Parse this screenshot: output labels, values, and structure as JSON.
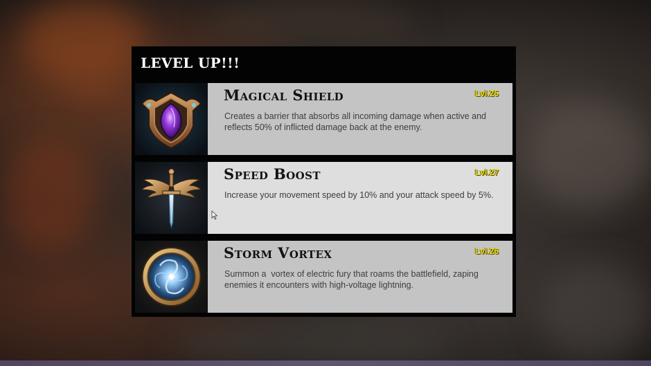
{
  "dialog": {
    "title": "LEVEL UP!!!"
  },
  "cards": [
    {
      "name": "Magical Shield",
      "level": "Lvl.25",
      "description": "Creates a barrier that absorbs all incoming damage when active and reflects 50% of inflicted damage back at the enemy.",
      "icon": "magic-shield-icon"
    },
    {
      "name": "Speed Boost",
      "level": "Lvl.27",
      "description": "Increase your movement speed by 10% and your attack speed by 5%.",
      "icon": "winged-sword-icon"
    },
    {
      "name": "Storm Vortex",
      "level": "Lvl.26",
      "description": "Summon a  vortex of electric fury that roams the battlefield, zaping enemies it encounters with high-voltage lightning.",
      "icon": "vortex-medallion-icon"
    }
  ],
  "colors": {
    "level_text": "#f2dd18",
    "card_bg": "#c4c4c4",
    "card_bg_hover": "#dedede",
    "panel_bg": "#030303"
  }
}
